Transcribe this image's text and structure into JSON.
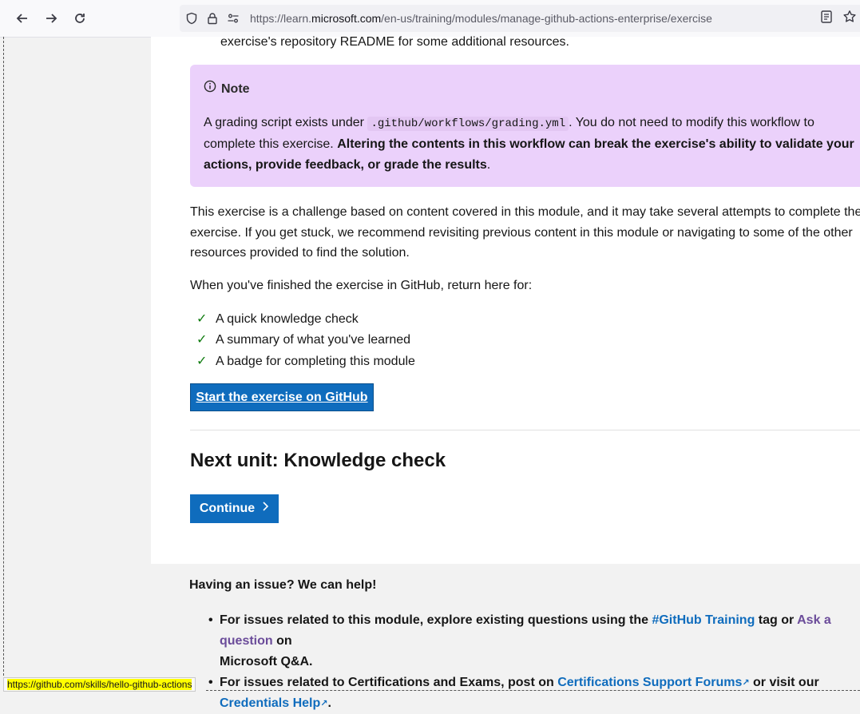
{
  "browser": {
    "url_prefix": "https://learn.",
    "url_domain": "microsoft.com",
    "url_path": "/en-us/training/modules/manage-github-actions-enterprise/exercise",
    "back_icon": "back-arrow-icon",
    "forward_icon": "forward-arrow-icon",
    "reload_icon": "reload-icon"
  },
  "content": {
    "readme_line": "exercise's repository README for some additional resources.",
    "note": {
      "title": "Note",
      "text_before": "A grading script exists under",
      "code": ".github/workflows/grading.yml",
      "text_after": ". You do not need to modify this workflow to complete this exercise.",
      "bold_text": "Altering the contents in this workflow can break the exercise's ability to validate your actions, provide feedback, or grade the results",
      "end": "."
    },
    "challenge_text": "This exercise is a challenge based on content covered in this module, and it may take several attempts to complete the exercise. If you get stuck, we recommend revisiting previous content in this module or navigating to some of the other resources provided to find the solution.",
    "return_text": "When you've finished the exercise in GitHub, return here for:",
    "checklist": [
      "A quick knowledge check",
      "A summary of what you've learned",
      "A badge for completing this module"
    ],
    "start_button": "Start the exercise on GitHub",
    "next_unit": "Next unit: Knowledge check",
    "continue_button": "Continue"
  },
  "help": {
    "title": "Having an issue? We can help!",
    "item1_text": "For issues related to this module, explore existing questions using the",
    "item1_link": "#GitHub Training",
    "item1_mid": "tag or",
    "item1_link2": "Ask a question",
    "item1_end": "on",
    "item1_line2": "Microsoft Q&A.",
    "item2_text": "For issues related to Certifications and Exams, post on",
    "item2_link": "Certifications Support Forums",
    "item2_mid": "or visit our",
    "item2_link2": "Credentials Help",
    "item2_end": "."
  },
  "status_bar": {
    "url": "https://github.com/skills/hello-github-actions"
  }
}
